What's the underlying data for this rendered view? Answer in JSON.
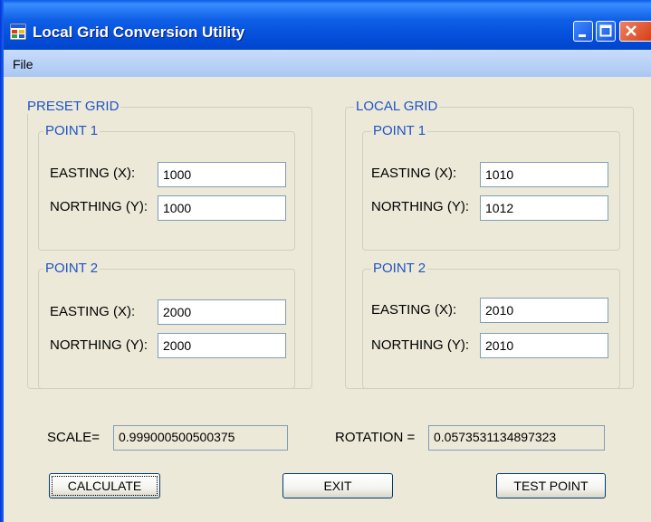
{
  "window": {
    "title": "Local Grid Conversion Utility"
  },
  "menu": {
    "file": "File"
  },
  "preset_grid": {
    "legend": "PRESET GRID",
    "point1": {
      "legend": "POINT 1",
      "easting_label": "EASTING (X):",
      "easting_value": "1000",
      "northing_label": "NORTHING (Y):",
      "northing_value": "1000"
    },
    "point2": {
      "legend": "POINT 2",
      "easting_label": "EASTING (X):",
      "easting_value": "2000",
      "northing_label": "NORTHING (Y):",
      "northing_value": "2000"
    }
  },
  "local_grid": {
    "legend": "LOCAL GRID",
    "point1": {
      "legend": "POINT 1",
      "easting_label": "EASTING (X):",
      "easting_value": "1010",
      "northing_label": "NORTHING (Y):",
      "northing_value": "1012"
    },
    "point2": {
      "legend": "POINT 2",
      "easting_label": "EASTING (X):",
      "easting_value": "2010",
      "northing_label": "NORTHING (Y):",
      "northing_value": "2010"
    }
  },
  "results": {
    "scale_label": "SCALE=",
    "scale_value": "0.999000500500375",
    "rotation_label": "ROTATION =",
    "rotation_value": "0.0573531134897323"
  },
  "buttons": {
    "calculate": "CALCULATE",
    "exit": "EXIT",
    "test_point": "TEST POINT"
  },
  "colors": {
    "titlebar": "#0550dc",
    "group_legend": "#1f53c6",
    "window_bg": "#ece9d8",
    "close_button": "#d43b14"
  }
}
